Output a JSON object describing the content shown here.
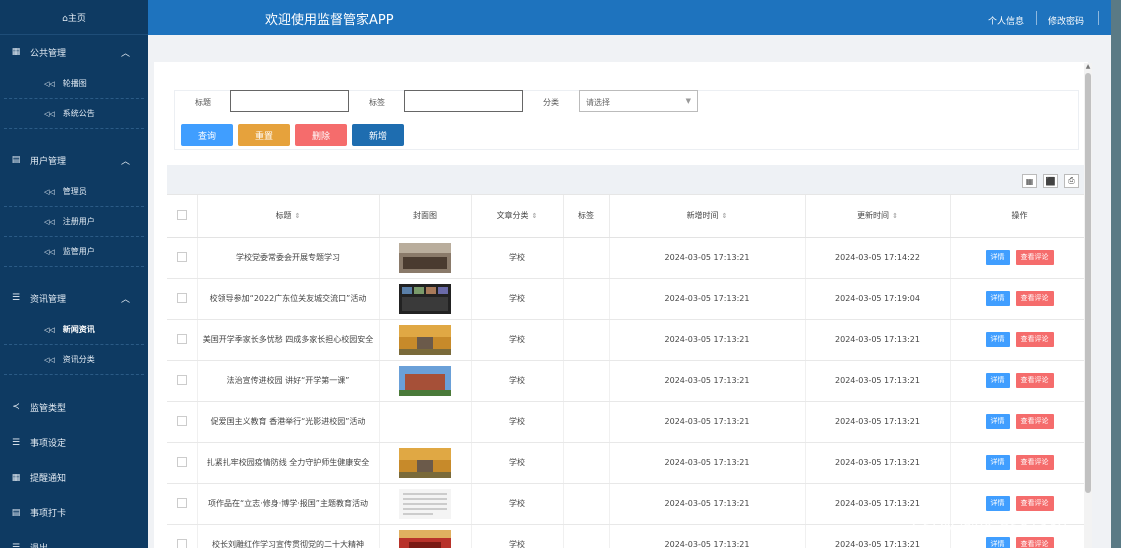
{
  "sidebar": {
    "home": "⌂主页",
    "groups": [
      {
        "label": "公共管理",
        "icon": "grid-icon",
        "items": [
          "轮播图",
          "系统公告"
        ]
      },
      {
        "label": "用户管理",
        "icon": "book-icon",
        "items": [
          "管理员",
          "注册用户",
          "监管用户"
        ]
      },
      {
        "label": "资讯管理",
        "icon": "list-icon",
        "items": [
          "新闻资讯",
          "资讯分类"
        ],
        "active_item": "新闻资讯"
      },
      {
        "label": "监管类型",
        "icon": "share-icon"
      },
      {
        "label": "事项设定",
        "icon": "list-icon"
      },
      {
        "label": "提醒通知",
        "icon": "grid-icon"
      },
      {
        "label": "事项打卡",
        "icon": "book-icon"
      },
      {
        "label": "退出",
        "icon": "list-icon"
      }
    ]
  },
  "header": {
    "title": "欢迎使用监督管家APP",
    "profile": "个人信息",
    "change_password": "修改密码"
  },
  "search": {
    "title_label": "标题",
    "tag_label": "标签",
    "category_label": "分类",
    "category_placeholder": "请选择",
    "buttons": {
      "query": "查询",
      "reset": "重置",
      "delete": "删除",
      "add": "新增"
    }
  },
  "table": {
    "headers": {
      "title": "标题",
      "cover": "封面图",
      "category": "文章分类",
      "tag": "标签",
      "created": "新增时间",
      "updated": "更新时间",
      "actions": "操作"
    },
    "sort_glyph": "⇕",
    "detail_label": "详情",
    "comment_label": "查看评论",
    "rows": [
      {
        "title": "学校党委常委会开展专题学习",
        "category": "学校",
        "tag": "",
        "created": "2024-03-05 17:13:21",
        "updated": "2024-03-05 17:14:22",
        "cover": "meeting"
      },
      {
        "title": "校领导参加“2022广东位关友城交流口”活动",
        "category": "学校",
        "tag": "",
        "created": "2024-03-05 17:13:21",
        "updated": "2024-03-05 17:19:04",
        "cover": "conference"
      },
      {
        "title": "美国开学季家长多忧愁 四成多家长担心校园安全",
        "category": "学校",
        "tag": "",
        "created": "2024-03-05 17:13:21",
        "updated": "2024-03-05 17:13:21",
        "cover": "autumn"
      },
      {
        "title": "法治宣传进校园 讲好“开学第一课”",
        "category": "学校",
        "tag": "",
        "created": "2024-03-05 17:13:21",
        "updated": "2024-03-05 17:13:21",
        "cover": "building"
      },
      {
        "title": "促爱国主义教育 香港举行“光影进校园”活动",
        "category": "学校",
        "tag": "",
        "created": "2024-03-05 17:13:21",
        "updated": "2024-03-05 17:13:21",
        "cover": ""
      },
      {
        "title": "扎紧扎牢校园疫情防线 全力守护师生健康安全",
        "category": "学校",
        "tag": "",
        "created": "2024-03-05 17:13:21",
        "updated": "2024-03-05 17:13:21",
        "cover": "autumn"
      },
      {
        "title": "项作品在“立志·修身·博学·报国”主题教育活动",
        "category": "学校",
        "tag": "",
        "created": "2024-03-05 17:13:21",
        "updated": "2024-03-05 17:13:21",
        "cover": "document"
      },
      {
        "title": "校长刘雕红作学习宣传贯彻党的二十大精神",
        "category": "学校",
        "tag": "",
        "created": "2024-03-05 17:13:21",
        "updated": "2024-03-05 17:13:21",
        "cover": "stage"
      }
    ]
  },
  "watermark": "CSDN @vx_BS81330",
  "colors": {
    "sidebar": "#0e3a62",
    "header": "#1e73be",
    "query": "#409eff",
    "reset": "#e6a23c",
    "delete": "#f56c6c",
    "add": "#1e6db0"
  }
}
